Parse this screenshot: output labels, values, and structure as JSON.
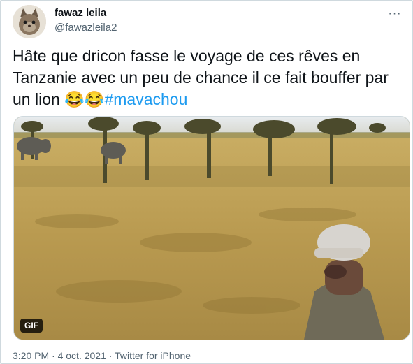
{
  "user": {
    "display_name": "fawaz leila",
    "handle": "@fawazleila2",
    "avatar_icon": "cat-avatar-icon"
  },
  "more_label": "···",
  "tweet": {
    "text_before": "Hâte que dricon fasse le voyage de ces rêves en Tanzanie avec un peu de chance il ce fait bouffer par un lion ",
    "emoji": "😂😂",
    "hashtag": "#mavachou"
  },
  "media": {
    "badge": "GIF",
    "description_icon": "safari-savanna-gif"
  },
  "meta": {
    "time": "3:20 PM",
    "date": "4 oct. 2021",
    "source": "Twitter for iPhone",
    "separator": " · "
  },
  "colors": {
    "text": "#0f1419",
    "secondary": "#536471",
    "link": "#1d9bf0",
    "border": "#cfd9de"
  }
}
